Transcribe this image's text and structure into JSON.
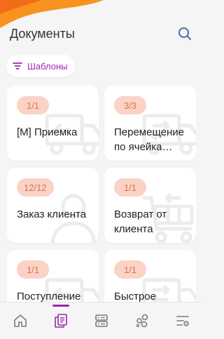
{
  "header": {
    "title": "Документы",
    "search_icon": "search-icon"
  },
  "filter_chip": {
    "label": "Шаблоны",
    "icon": "filter-icon"
  },
  "cards": [
    {
      "badge": "1/1",
      "label": "[M] Приемка",
      "icon": "truck-arrow-left-icon"
    },
    {
      "badge": "3/3",
      "label": "Перемещение по ячейка…",
      "icon": "truck-arrows-icon"
    },
    {
      "badge": "12/12",
      "label": "Заказ клиента",
      "icon": "user-icon"
    },
    {
      "badge": "1/1",
      "label": "Возврат от клиента",
      "icon": "cart-return-icon"
    },
    {
      "badge": "1/1",
      "label": "Поступление",
      "icon": "truck-arrow-left-icon"
    },
    {
      "badge": "1/1",
      "label": "Быстрое",
      "icon": "truck-arrows-icon"
    }
  ],
  "tabbar": {
    "items": [
      {
        "name": "home",
        "icon": "home-icon",
        "active": false
      },
      {
        "name": "documents",
        "icon": "documents-icon",
        "active": true
      },
      {
        "name": "catalog",
        "icon": "server-icon",
        "active": false
      },
      {
        "name": "bubbles",
        "icon": "bubbles-icon",
        "active": false
      },
      {
        "name": "settings",
        "icon": "settings-icon",
        "active": false
      }
    ]
  },
  "colors": {
    "accent": "#9c27b0",
    "badge_bg": "#fbd2c6",
    "badge_text": "#e07050",
    "blob": "#f7931e",
    "icon_gray": "#7a7a7a",
    "search_icon": "#4a6fa5"
  }
}
